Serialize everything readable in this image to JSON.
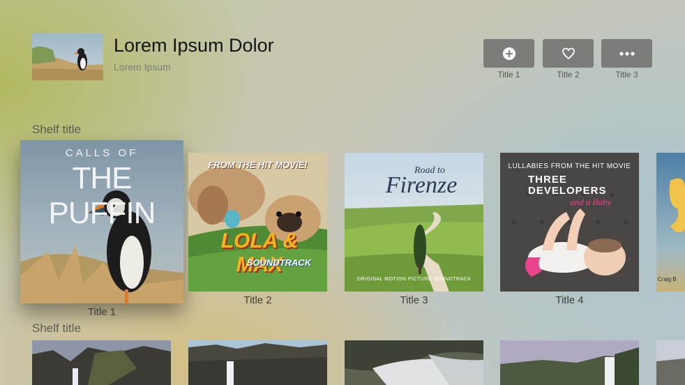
{
  "header": {
    "title": "Lorem Ipsum Dolor",
    "subtitle": "Lorem Ipsum"
  },
  "actions": [
    {
      "label": "Title 1",
      "icon": "plus-circle-icon"
    },
    {
      "label": "Title 2",
      "icon": "heart-icon"
    },
    {
      "label": "Title 3",
      "icon": "ellipsis-icon"
    }
  ],
  "shelves": [
    {
      "title": "Shelf title",
      "items": [
        {
          "label": "Title 1",
          "art": {
            "line1": "CALLS OF",
            "line2": "THE PUFFIN"
          },
          "focused": true
        },
        {
          "label": "Title 2",
          "art": {
            "top": "FROM THE HIT MOVIE!",
            "main": "LOLA & MAX",
            "sub": "SOUNDTRACK"
          }
        },
        {
          "label": "Title 3",
          "art": {
            "small": "Road to",
            "main": "Firenze",
            "foot": "ORIGINAL MOTION PICTURE SOUNDTRACK"
          }
        },
        {
          "label": "Title 4",
          "art": {
            "top": "LULLABIES FROM THE HIT MOVIE",
            "main1": "THREE",
            "main2": "DEVELOPERS",
            "script": "and a Baby"
          }
        },
        {
          "label": "",
          "art": {
            "corner": "Craig B"
          }
        }
      ]
    },
    {
      "title": "Shelf title",
      "items": []
    }
  ],
  "colors": {
    "button_bg": "#7c7d79",
    "label": "#3d3f38"
  }
}
